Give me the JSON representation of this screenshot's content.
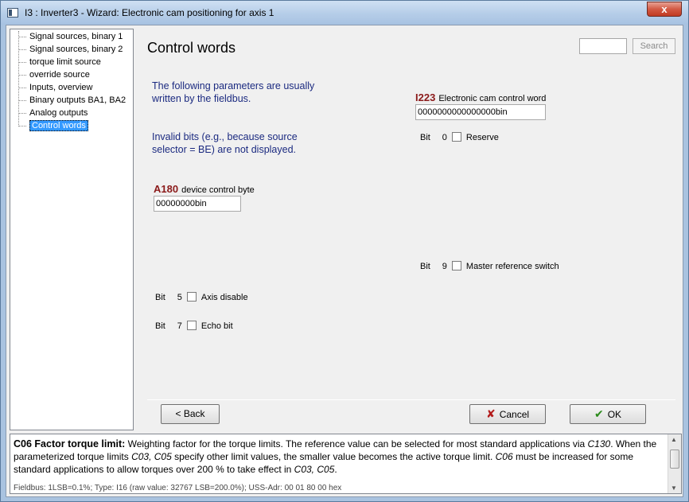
{
  "window": {
    "title": "I3 : Inverter3 - Wizard: Electronic cam positioning for axis 1",
    "close_label": "x"
  },
  "tree": {
    "items": [
      {
        "label": "Signal sources, binary 1"
      },
      {
        "label": "Signal sources, binary 2"
      },
      {
        "label": "torque limit source"
      },
      {
        "label": "override source"
      },
      {
        "label": "Inputs, overview"
      },
      {
        "label": "Binary outputs BA1, BA2"
      },
      {
        "label": "Analog outputs"
      },
      {
        "label": "Control words",
        "selected": true
      }
    ]
  },
  "main": {
    "title": "Control words",
    "search_value": "",
    "search_label": "Search",
    "info1_line1": "The following parameters are usually",
    "info1_line2": "written by the fieldbus.",
    "info2_line1": "Invalid bits (e.g., because source",
    "info2_line2": "selector = BE) are not displayed.",
    "param_a180": {
      "code": "A180",
      "name": "device control byte",
      "value": "00000000bin",
      "bits": [
        {
          "bit_label": "Bit",
          "bit_num": "5",
          "label": "Axis disable",
          "checked": false
        },
        {
          "bit_label": "Bit",
          "bit_num": "7",
          "label": "Echo bit",
          "checked": false
        }
      ]
    },
    "param_i223": {
      "code": "I223",
      "name": "Electronic cam control word",
      "value": "0000000000000000bin",
      "bits": [
        {
          "bit_label": "Bit",
          "bit_num": "0",
          "label": "Reserve",
          "checked": false
        },
        {
          "bit_label": "Bit",
          "bit_num": "9",
          "label": "Master reference switch",
          "checked": false
        }
      ]
    },
    "buttons": {
      "back": "< Back",
      "cancel": "Cancel",
      "ok": "OK"
    }
  },
  "description": {
    "heading": "C06  Factor torque limit:",
    "text_part1": " Weighting factor for the torque limits. The reference value can be selected for most standard applications via ",
    "ref_c130": "C130",
    "text_part2": ". When the parameterized torque limits ",
    "ref_c03_c05": "C03, C05",
    "text_part3": " specify other limit values, the smaller value becomes the active torque limit. ",
    "ref_c06": "C06",
    "text_part4": " must be increased for some standard applications to allow torques over 200 % to take effect in ",
    "ref_c03_c05_end": "C03, C05",
    "text_part5": ".",
    "cut_line": "Fieldbus: 1LSB=0.1%; Type: I16 (raw value: 32767 LSB=200.0%); USS-Adr: 00 01 80 00 hex"
  },
  "colors": {
    "param_code": "#8b1a1a",
    "info_text": "#1b2a80",
    "selected_item": "#3399ff"
  }
}
